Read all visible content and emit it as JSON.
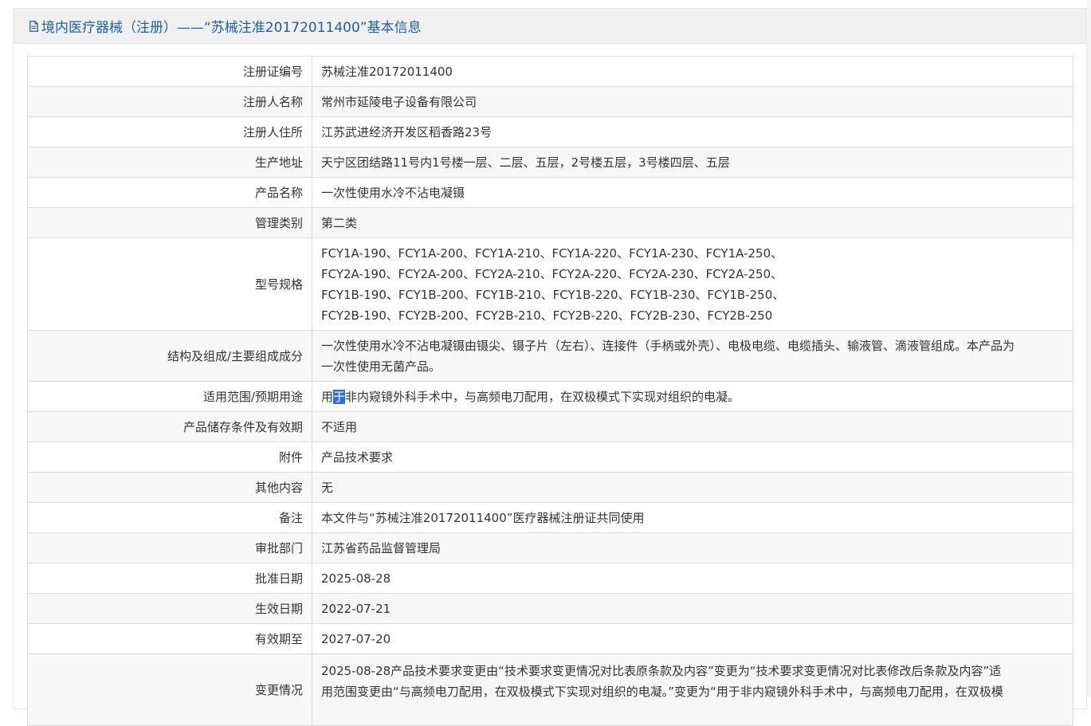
{
  "header": {
    "title": "境内医疗器械（注册）——“苏械注准20172011400”基本信息"
  },
  "rows": [
    {
      "label": "注册证编号",
      "value": "苏械注准20172011400"
    },
    {
      "label": "注册人名称",
      "value": "常州市延陵电子设备有限公司"
    },
    {
      "label": "注册人住所",
      "value": "江苏武进经济开发区稻香路23号"
    },
    {
      "label": "生产地址",
      "value": "天宁区团结路11号内1号楼一层、二层、五层，2号楼五层，3号楼四层、五层"
    },
    {
      "label": "产品名称",
      "value": "一次性使用水冷不沾电凝镊"
    },
    {
      "label": "管理类别",
      "value": "第二类"
    },
    {
      "label": "型号规格",
      "lines": [
        "FCY1A-190、FCY1A-200、FCY1A-210、FCY1A-220、FCY1A-230、FCY1A-250、",
        "FCY2A-190、FCY2A-200、FCY2A-210、FCY2A-220、FCY2A-230、FCY2A-250、",
        "FCY1B-190、FCY1B-200、FCY1B-210、FCY1B-220、FCY1B-230、FCY1B-250、",
        "FCY2B-190、FCY2B-200、FCY2B-210、FCY2B-220、FCY2B-230、FCY2B-250"
      ]
    },
    {
      "label": "结构及组成/主要组成成分",
      "lines": [
        "一次性使用水冷不沾电凝镊由镊尖、镊子片（左右）、连接件（手柄或外壳）、电极电缆、电缆插头、输液管、滴液管组成。本产品为",
        "一次性使用无菌产品。"
      ]
    },
    {
      "label": "适用范围/预期用途",
      "value_pre": "用",
      "value_sel": "于",
      "value_post": "非内窥镜外科手术中，与高频电刀配用，在双极模式下实现对组织的电凝。"
    },
    {
      "label": "产品储存条件及有效期",
      "value": "不适用"
    },
    {
      "label": "附件",
      "value": "产品技术要求"
    },
    {
      "label": "其他内容",
      "value": "无"
    },
    {
      "label": "备注",
      "value": "本文件与“苏械注准20172011400”医疗器械注册证共同使用"
    },
    {
      "label": "审批部门",
      "value": "江苏省药品监督管理局"
    },
    {
      "label": "批准日期",
      "value": "2025-08-28"
    },
    {
      "label": "生效日期",
      "value": "2022-07-21"
    },
    {
      "label": "有效期至",
      "value": "2027-07-20"
    },
    {
      "label": "变更情况",
      "lines": [
        "2025-08-28产品技术要求变更由“技术要求变更情况对比表原条款及内容”变更为“技术要求变更情况对比表修改后条款及内容”适",
        "用范围变更由“与高频电刀配用，在双极模式下实现对组织的电凝。”变更为“用于非内窥镜外科手术中，与高频电刀配用，在双极模"
      ]
    }
  ]
}
